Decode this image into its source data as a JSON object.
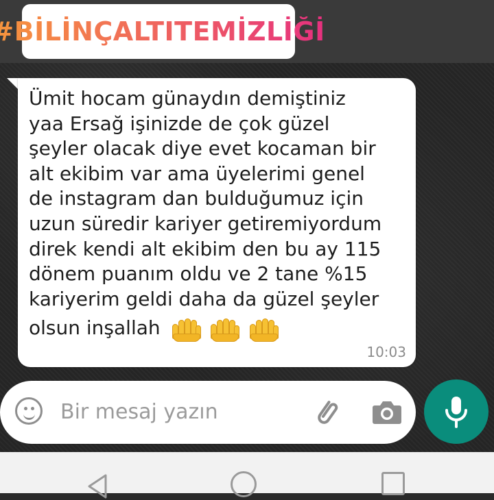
{
  "overlay": {
    "hashtag": "#BİLİNÇALTITEMİZLİĞİ"
  },
  "message": {
    "lines": [
      "Ümit hocam günaydın  demiştiniz",
      "yaa Ersağ işinizde de çok güzel",
      "şeyler olacak diye evet kocaman bir",
      "alt ekibim var ama üyelerimi genel",
      "de instagram dan bulduğumuz için",
      "uzun süredir kariyer getiremiyordum",
      "direk kendi alt ekibim den  bu ay 115",
      "dönem puanım oldu ve 2 tane %15",
      "kariyerim geldi daha da güzel şeyler",
      "olsun inşallah"
    ],
    "emoji": "raising-hands-emoji x3",
    "time": "10:03"
  },
  "composer": {
    "placeholder": "Bir mesaj yazın",
    "icons": [
      "smiley-icon",
      "paperclip-icon",
      "camera-icon",
      "microphone-icon"
    ],
    "accent_color": "#0a8d7c"
  },
  "navigation": {
    "icons": [
      "back-icon",
      "home-icon",
      "recent-apps-icon"
    ]
  }
}
